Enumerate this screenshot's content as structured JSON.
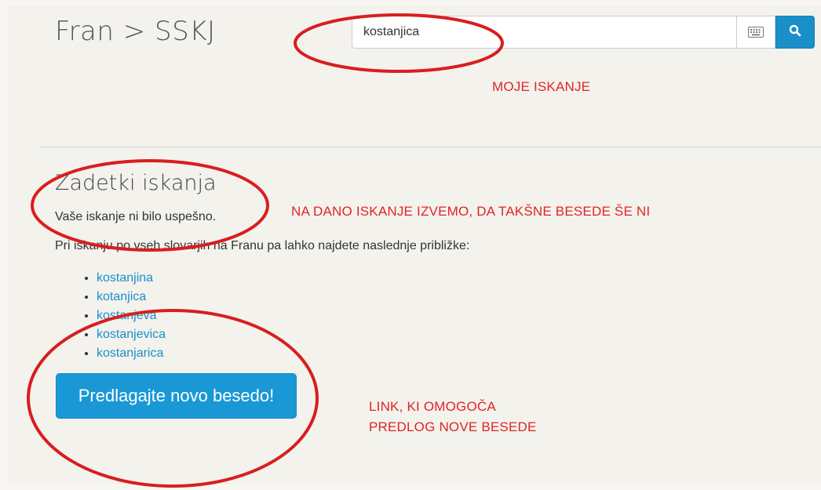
{
  "header": {
    "brand": "Fran > SSKJ",
    "search_value": "kostanjica",
    "keyboard_icon": "keyboard-icon",
    "search_icon": "search-icon"
  },
  "results": {
    "title": "Zadetki iskanja",
    "no_result_text": "Vaše iskanje ni bilo uspešno.",
    "suggest_intro": "Pri iskanju po vseh slovarjih na Franu pa lahko najdete naslednje približke:",
    "suggestions": [
      "kostanjina",
      "kotanjica",
      "kostanjeva",
      "kostanjevica",
      "kostanjarica"
    ],
    "propose_button": "Predlagajte novo besedo!"
  },
  "annotations": {
    "note_search": "MOJE ISKANJE",
    "note_result": "NA DANO ISKANJE IZVEMO, DA TAKŠNE BESEDE ŠE NI",
    "note_link_line1": "LINK, KI OMOGOČA",
    "note_link_line2": "PREDLOG NOVE BESEDE",
    "color": "#e02525"
  },
  "colors": {
    "accent": "#1a8fc9",
    "button": "#1a98d6",
    "background": "#f3f2ed"
  }
}
